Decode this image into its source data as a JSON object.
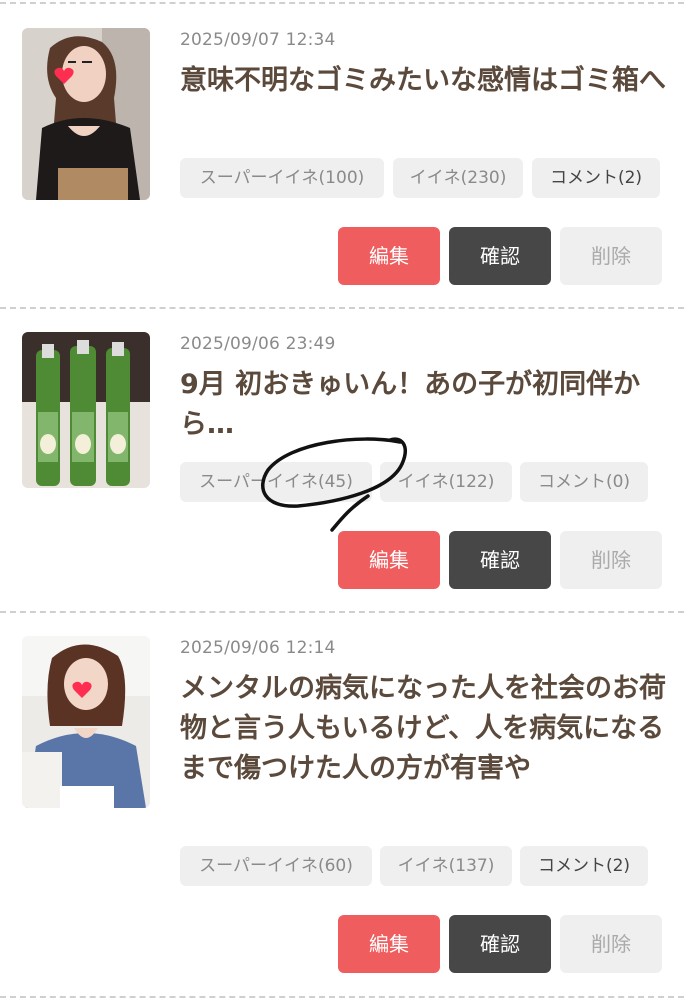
{
  "posts": [
    {
      "date": "2025/09/07 12:34",
      "title": "意味不明なゴミみたいな感情はゴミ箱へ",
      "super_like": "スーパーイイネ(100)",
      "like": "イイネ(230)",
      "comment": "コメント(2)",
      "edit": "編集",
      "confirm": "確認",
      "delete": "削除"
    },
    {
      "date": "2025/09/06 23:49",
      "title": "9月 初おきゅいん！あの子が初同伴から…",
      "super_like": "スーパーイイネ(45)",
      "like": "イイネ(122)",
      "comment": "コメント(0)",
      "edit": "編集",
      "confirm": "確認",
      "delete": "削除"
    },
    {
      "date": "2025/09/06 12:14",
      "title": "メンタルの病気になった人を社会のお荷物と言う人もいるけど、人を病気になるまで傷つけた人の方が有害や",
      "super_like": "スーパーイイネ(60)",
      "like": "イイネ(137)",
      "comment": "コメント(2)",
      "edit": "編集",
      "confirm": "確認",
      "delete": "削除"
    }
  ],
  "colors": {
    "edit_button": "#ef5d5e",
    "confirm_button": "#474747",
    "delete_button": "#efefef",
    "title_text": "#5b4a3c"
  }
}
